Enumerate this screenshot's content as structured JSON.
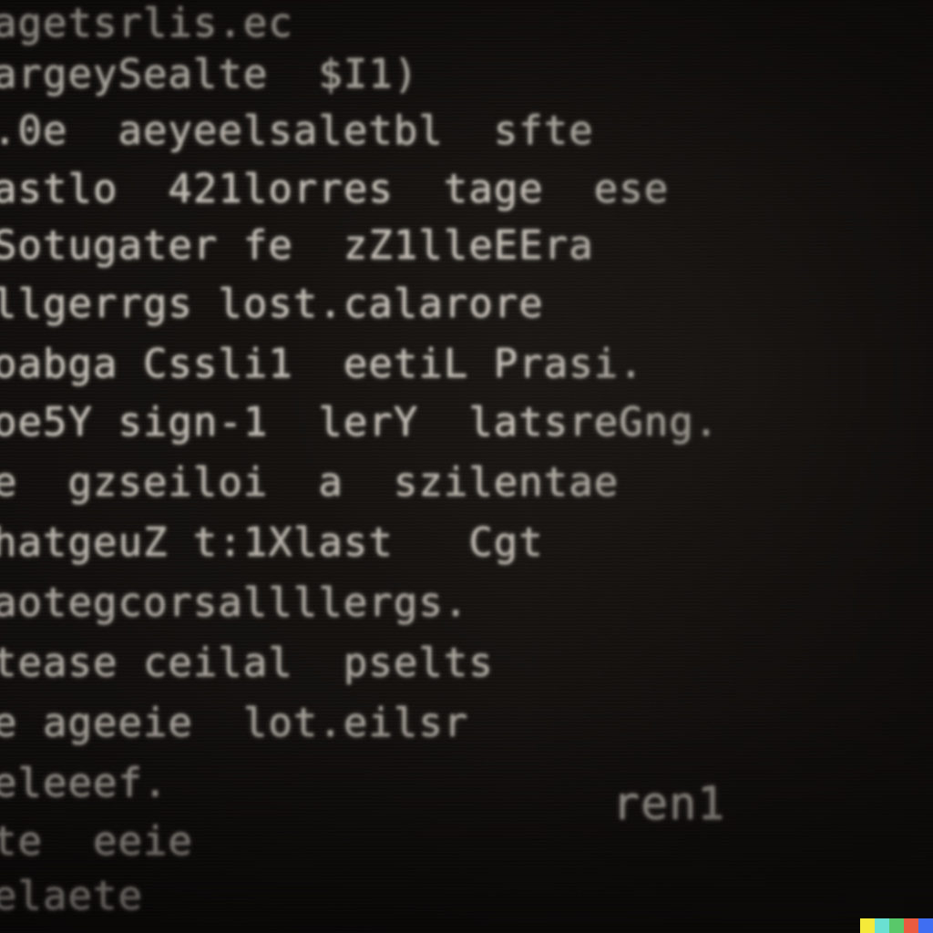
{
  "terminal": {
    "lines": [
      "agetsrlis.ec",
      "argeySealte  $I1)",
      ".0e  aeyeelsaletbl  sfte",
      "astlo  421lorres  tage  ese",
      "Sotugater fe  zZ1lleEEra",
      "llgerrgs lost.calarore",
      "oabga Cssli1  eetiL Prasi.",
      "oe5Y sign-1  lerY  latsreGng.",
      "e  gzseiloi  a  szilentae",
      "hatgeuZ t:1Xlast   Cgt",
      "aotegcorsallllergs.",
      "tease ceilal  pselts",
      "e ageeie  lot.eilsr",
      "eleeef.",
      "te  eeie",
      "elaete"
    ],
    "prompt_fragment": "ren1"
  },
  "watermark": {
    "colors": [
      "#f5e93a",
      "#69e0d2",
      "#58c86a",
      "#ea5b3f",
      "#3f6ef2"
    ]
  }
}
